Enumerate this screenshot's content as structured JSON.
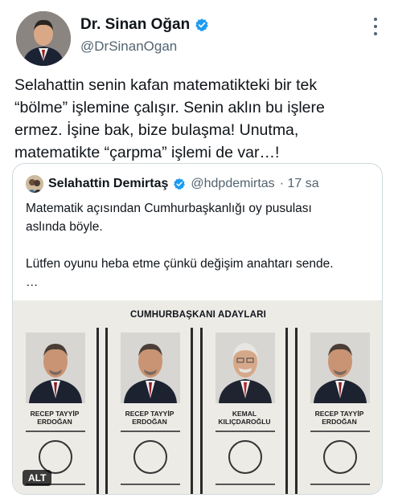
{
  "author": {
    "display_name": "Dr. Sinan Oğan",
    "handle": "@DrSinanOgan",
    "verified_color": "#1d9bf0"
  },
  "tweet": {
    "lines": [
      "Selahattin senin kafan matematikteki bir tek",
      "“bölme” işlemine çalışır. Senin aklın bu işlere",
      "ermez. İşine bak, bize bulaşma! Unutma,",
      "matematikte “çarpma” işlemi de var…!"
    ]
  },
  "quote": {
    "display_name": "Selahattin Demirtaş",
    "handle": "@hdpdemirtas",
    "time": "· 17 sa",
    "lines": [
      "Matematik açısından Cumhurbaşkanlığı oy pusulası",
      "aslında böyle.",
      "",
      "Lütfen oyunu heba etme çünkü değişim anahtarı sende.",
      "…"
    ],
    "media": {
      "ballot_title": "CUMHURBAŞKANI ADAYLARI",
      "candidates": [
        {
          "line1": "RECEP TAYYİP",
          "line2": "ERDOĞAN"
        },
        {
          "line1": "RECEP TAYYİP",
          "line2": "ERDOĞAN"
        },
        {
          "line1": "KEMAL",
          "line2": "KILIÇDAROĞLU"
        },
        {
          "line1": "RECEP TAYYİP",
          "line2": "ERDOĞAN"
        }
      ],
      "alt_label": "ALT"
    }
  },
  "icons": [
    "verified-badge-icon",
    "more-options-icon"
  ]
}
